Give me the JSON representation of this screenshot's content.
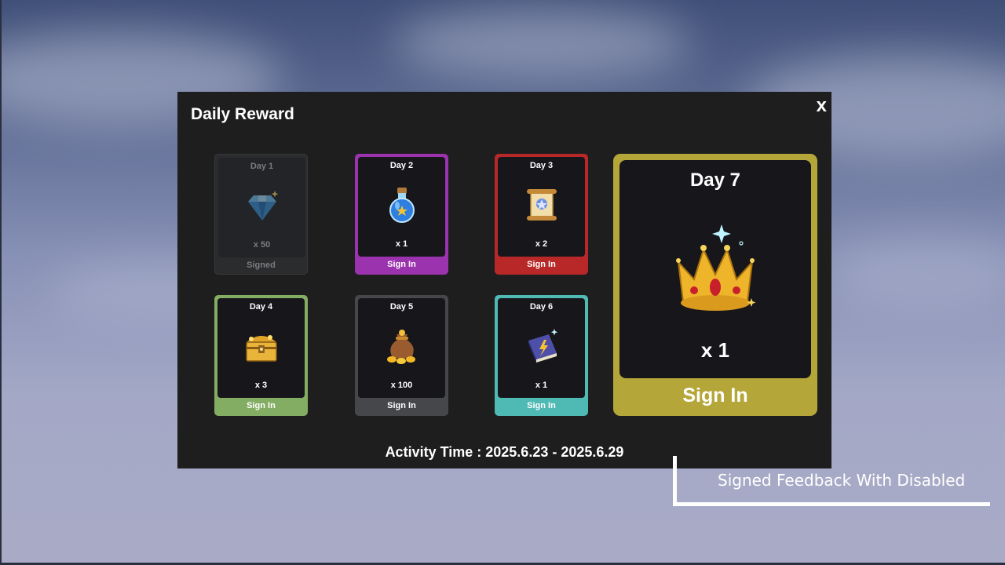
{
  "panel": {
    "title": "Daily Reward",
    "close_label": "x",
    "activity_label": "Activity Time : 2025.6.23 - 2025.6.29"
  },
  "days": [
    {
      "day": "Day 1",
      "qty": "x 50",
      "action": "Signed",
      "icon": "diamond-icon",
      "status": "signed",
      "color": "#2b2c2e"
    },
    {
      "day": "Day 2",
      "qty": "x 1",
      "action": "Sign In",
      "icon": "potion-icon",
      "status": "available",
      "color": "#9a33ad"
    },
    {
      "day": "Day 3",
      "qty": "x 2",
      "action": "Sign In",
      "icon": "scroll-icon",
      "status": "available",
      "color": "#b82828"
    },
    {
      "day": "Day 4",
      "qty": "x 3",
      "action": "Sign In",
      "icon": "treasure-chest-icon",
      "status": "available",
      "color": "#84ad64"
    },
    {
      "day": "Day 5",
      "qty": "x 100",
      "action": "Sign In",
      "icon": "coin-bag-icon",
      "status": "available",
      "color": "#46474b"
    },
    {
      "day": "Day 6",
      "qty": "x 1",
      "action": "Sign In",
      "icon": "spellbook-icon",
      "status": "available",
      "color": "#4fb9b4"
    },
    {
      "day": "Day 7",
      "qty": "x 1",
      "action": "Sign In",
      "icon": "crown-icon",
      "status": "available",
      "color": "#b5a63a"
    }
  ],
  "callout": {
    "text": "Signed Feedback With Disabled"
  }
}
